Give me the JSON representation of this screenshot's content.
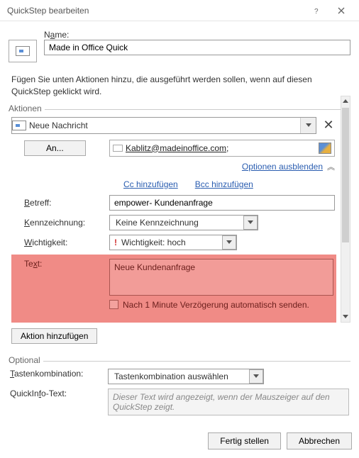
{
  "titlebar": {
    "title": "QuickStep bearbeiten"
  },
  "name": {
    "label_pre": "N",
    "label_u": "a",
    "label_post": "me:",
    "value": "Made in Office Quick"
  },
  "intro": "Fügen Sie unten Aktionen hinzu, die ausgeführt werden sollen, wenn auf diesen QuickStep geklickt wird.",
  "actions": {
    "legend": "Aktionen",
    "selected": "Neue Nachricht",
    "to_button_pre": "A",
    "to_button_u": "n",
    "to_button_post": "...",
    "recipient": "Kablitz@madeinoffice.com;",
    "options_link": "Optionen ausblenden",
    "cc_pre": "",
    "cc_u": "C",
    "cc_post": "c hinzufügen",
    "bcc_pre": "",
    "bcc_u": "B",
    "bcc_post": "cc hinzufügen",
    "subject_label_u": "B",
    "subject_label_post": "etreff:",
    "subject_value": "empower- Kundenanfrage",
    "flag_label_u": "K",
    "flag_label_post": "ennzeichnung:",
    "flag_value": "Keine Kennzeichnung",
    "importance_label_u": "W",
    "importance_label_post": "ichtigkeit:",
    "importance_value": "Wichtigkeit: hoch",
    "text_label_pre": "Te",
    "text_label_u": "x",
    "text_label_post": "t:",
    "text_value": "Neue Kundenanfrage",
    "delay_pre": "Nach 1 Minute Verzögerung auto",
    "delay_u": "m",
    "delay_post": "atisch senden.",
    "add_action": "Aktion hinzufügen"
  },
  "optional": {
    "legend": "Optional",
    "shortcut_label_u": "T",
    "shortcut_label_post": "astenkombination:",
    "shortcut_value": "Tastenkombination auswählen",
    "tooltip_label_pre": "QuickIn",
    "tooltip_label_u": "f",
    "tooltip_label_post": "o-Text:",
    "tooltip_placeholder": "Dieser Text wird angezeigt, wenn der Mauszeiger auf den QuickStep zeigt."
  },
  "footer": {
    "ok_pre": "",
    "ok_u": "F",
    "ok_post": "ertig stellen",
    "cancel": "Abbrechen"
  }
}
